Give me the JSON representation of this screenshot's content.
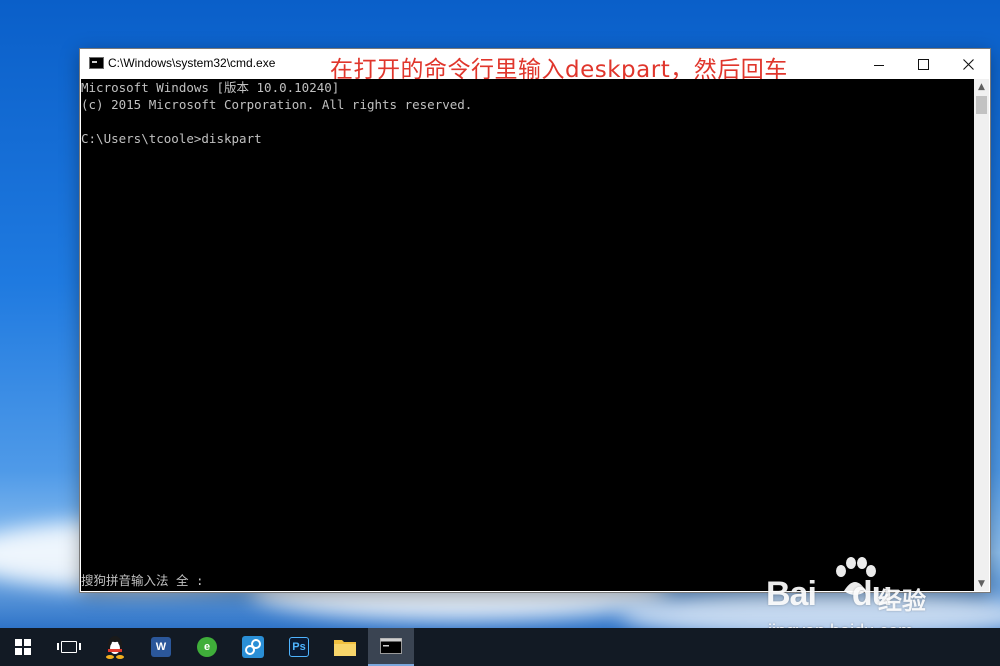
{
  "window": {
    "title": "C:\\Windows\\system32\\cmd.exe",
    "minimize_label": "—",
    "maximize_label": "☐",
    "close_label": "✕"
  },
  "overlay_caption": "在打开的命令行里输入deskpart，然后回车",
  "console": {
    "lines": [
      "Microsoft Windows [版本 10.0.10240]",
      "(c) 2015 Microsoft Corporation. All rights reserved.",
      "",
      "C:\\Users\\tcoole>diskpart"
    ],
    "ime_status": "搜狗拼音输入法 全 :"
  },
  "taskbar": {
    "items": [
      {
        "name": "start",
        "icon": "windows-logo-icon"
      },
      {
        "name": "task-view",
        "icon": "task-view-icon"
      },
      {
        "name": "qq",
        "icon": "qq-penguin-icon"
      },
      {
        "name": "word",
        "icon": "word-icon",
        "glyph": "W"
      },
      {
        "name": "browser",
        "icon": "green-browser-icon",
        "glyph": "e"
      },
      {
        "name": "network-tool",
        "icon": "blue-app-icon"
      },
      {
        "name": "photoshop",
        "icon": "photoshop-icon",
        "glyph": "Ps"
      },
      {
        "name": "file-explorer",
        "icon": "folder-icon"
      },
      {
        "name": "cmd",
        "icon": "cmd-icon",
        "active": true
      }
    ]
  },
  "watermark": {
    "logo_text_left": "Bai",
    "logo_text_right": "du",
    "jingyan_label": "经验",
    "url": "jingyan.baidu.com"
  },
  "colors": {
    "caption": "#e0362c",
    "console_bg": "#000000",
    "console_text": "#c0c0c0",
    "taskbar_bg": "#121a24"
  }
}
